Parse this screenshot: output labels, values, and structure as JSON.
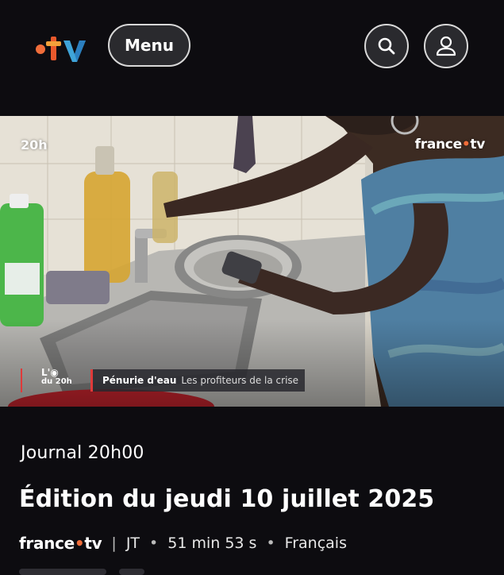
{
  "header": {
    "logo_text": "•tv",
    "menu_label": "Menu",
    "search_icon": "search-icon",
    "account_icon": "user-icon"
  },
  "video": {
    "channel_badge": "20h",
    "watermark_main": "france",
    "watermark_dot": "•",
    "watermark_tv": "tv",
    "lower_third": {
      "show_line1": "L'",
      "show_line2": "du 20h",
      "topic": "Pénurie d'eau",
      "subtitle": "Les profiteurs de la crise"
    }
  },
  "program": {
    "show_title": "Journal 20h00",
    "episode_title": "Édition du jeudi 10 juillet 2025",
    "meta": {
      "brand_main": "france",
      "brand_dot": "•",
      "brand_tv": "tv",
      "separator": "|",
      "category": "JT",
      "bullet": "•",
      "duration": "51 min 53 s",
      "language": "Français"
    }
  },
  "colors": {
    "background": "#0d0c10",
    "accent_orange": "#f06d3a",
    "accent_red": "#e03a3a"
  }
}
